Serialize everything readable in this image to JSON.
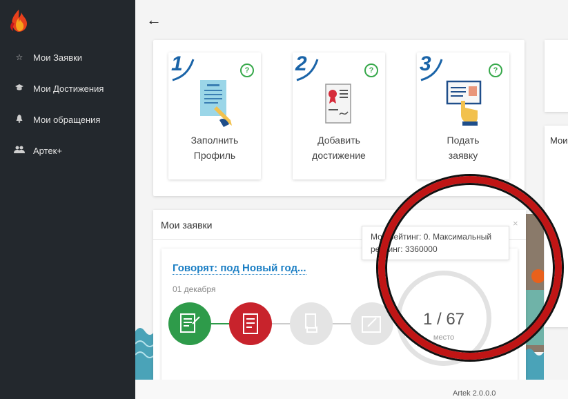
{
  "nav": {
    "items": [
      {
        "label": "Мои Заявки",
        "icon": "star-icon"
      },
      {
        "label": "Мои Достижения",
        "icon": "graduation-cap-icon"
      },
      {
        "label": "Мои обращения",
        "icon": "bell-icon"
      },
      {
        "label": "Артек+",
        "icon": "users-icon"
      }
    ]
  },
  "header": {
    "back_icon": "arrow-left-icon"
  },
  "steps": [
    {
      "number": "1",
      "line1": "Заполнить",
      "line2": "Профиль",
      "help": "?"
    },
    {
      "number": "2",
      "line1": "Добавить",
      "line2": "достижение",
      "help": "?"
    },
    {
      "number": "3",
      "line1": "Подать",
      "line2": "заявку",
      "help": "?"
    }
  ],
  "right_panel": {
    "title": "Мои"
  },
  "applications": {
    "title": "Мои заявки",
    "close": "×",
    "item": {
      "title": "Говорят: под Новый год...",
      "date": "01 декабря",
      "rank": "1 / 67",
      "rank_label": "место"
    },
    "tooltip": "Мой рейтинг: 0. Максимальный рейтинг: 3360000"
  },
  "footer": {
    "version": "Artek 2.0.0.0"
  },
  "colors": {
    "sidebar": "#23282d",
    "accent_blue": "#1a64a8",
    "link_blue": "#1a7ec4",
    "green": "#2e9b4a",
    "red": "#c8232c",
    "highlight": "#c01515"
  }
}
